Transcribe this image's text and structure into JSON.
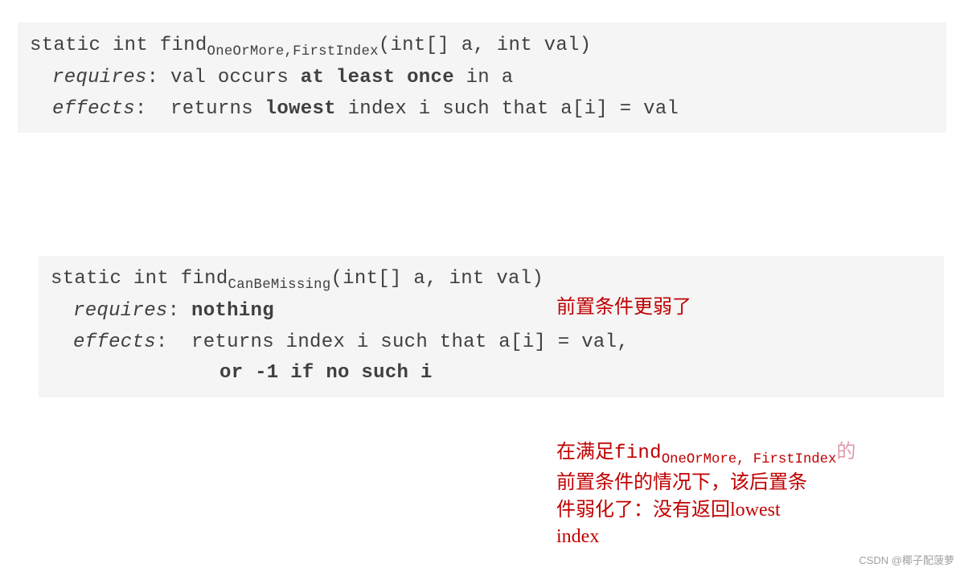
{
  "block1": {
    "sig_pre": "static int find",
    "sig_sub": "OneOrMore,FirstIndex",
    "sig_post": "(int[] a, int val)",
    "requires_label": "requires",
    "requires_pre": ": val occurs ",
    "requires_bold": "at least once",
    "requires_post": " in a",
    "effects_label": "effects",
    "effects_pre": ":  returns ",
    "effects_bold": "lowest",
    "effects_post": " index i such that a[i] = val"
  },
  "block2": {
    "sig_pre": "static int find",
    "sig_sub": "CanBeMissing",
    "sig_post": "(int[] a, int val)",
    "requires_label": "requires",
    "requires_pre": ": ",
    "requires_bold": "nothing",
    "effects_label": "effects",
    "effects_text": ":  returns index i such that a[i] = val,",
    "effects_line2_bold": "or -1 if no such i"
  },
  "annot1": "前置条件更弱了",
  "annot2": {
    "l1_pre": "在满足",
    "l1_find": "find",
    "l1_sub": "OneOrMore, FirstIndex",
    "l1_post": "的",
    "l2": "前置条件的情况下，该后置条",
    "l3": "件弱化了：没有返回lowest",
    "l4": "index"
  },
  "watermark": "CSDN @椰子配菠萝"
}
